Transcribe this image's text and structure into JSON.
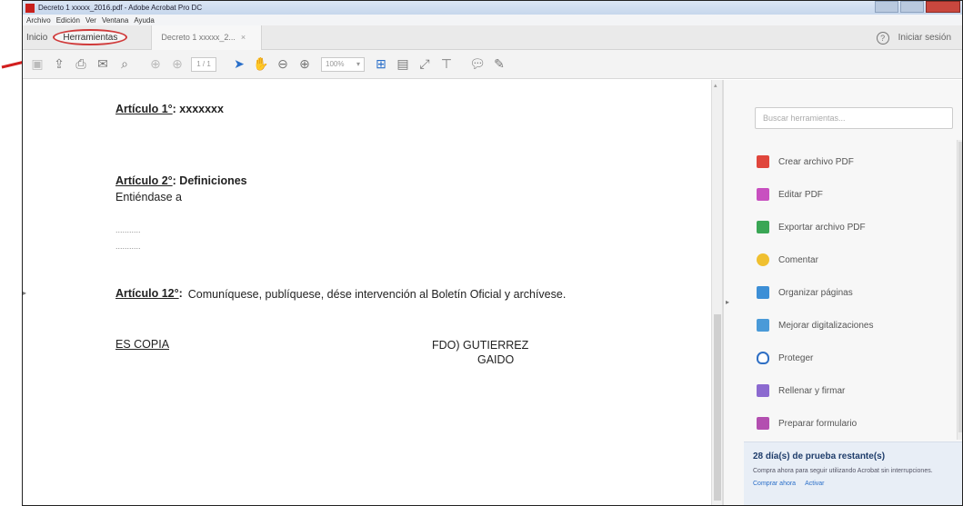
{
  "window": {
    "title": "Decreto 1 xxxxx_2016.pdf - Adobe Acrobat Pro DC"
  },
  "menu": [
    "Archivo",
    "Edición",
    "Ver",
    "Ventana",
    "Ayuda"
  ],
  "tabs": {
    "inicio": "Inicio",
    "herramientas": "Herramientas",
    "document": "Decreto 1 xxxxx_2...",
    "close": "×",
    "signin": "Iniciar sesión"
  },
  "toolbar": {
    "page_current": "1",
    "page_total": "/ 1",
    "zoom": "100%"
  },
  "document": {
    "art1_label": "Artículo 1°",
    "art1_text": ": xxxxxxx",
    "art2_label": "Artículo 2°",
    "art2_text": ": Definiciones",
    "art2_body": "Entiéndase a",
    "dots": "...........",
    "art12_label": "Artículo 12°",
    "art12_text": "Comuníquese, publíquese, dése intervención al Boletín Oficial y archívese.",
    "es_copia": "ES COPIA",
    "fdo_line1": "FDO)  GUTIERREZ",
    "fdo_line2": "GAIDO"
  },
  "tools_pane": {
    "search_placeholder": "Buscar herramientas...",
    "items": [
      {
        "label": "Crear archivo PDF",
        "color": "#e0463c"
      },
      {
        "label": "Editar PDF",
        "color": "#c850c0"
      },
      {
        "label": "Exportar archivo PDF",
        "color": "#3aa655"
      },
      {
        "label": "Comentar",
        "color": "#f0c030"
      },
      {
        "label": "Organizar páginas",
        "color": "#3d8fd6"
      },
      {
        "label": "Mejorar digitalizaciones",
        "color": "#4a9ad8"
      },
      {
        "label": "Proteger",
        "color": "#2f6fc4"
      },
      {
        "label": "Rellenar y firmar",
        "color": "#8c6ad0"
      },
      {
        "label": "Preparar formulario",
        "color": "#b34fb0"
      }
    ],
    "trial_title": "28 día(s) de prueba restante(s)",
    "trial_text": "Compra ahora para seguir utilizando Acrobat sin interrupciones.",
    "buy_link": "Comprar ahora",
    "activate_link": "Activar"
  },
  "accent_color": "#d03a3a"
}
